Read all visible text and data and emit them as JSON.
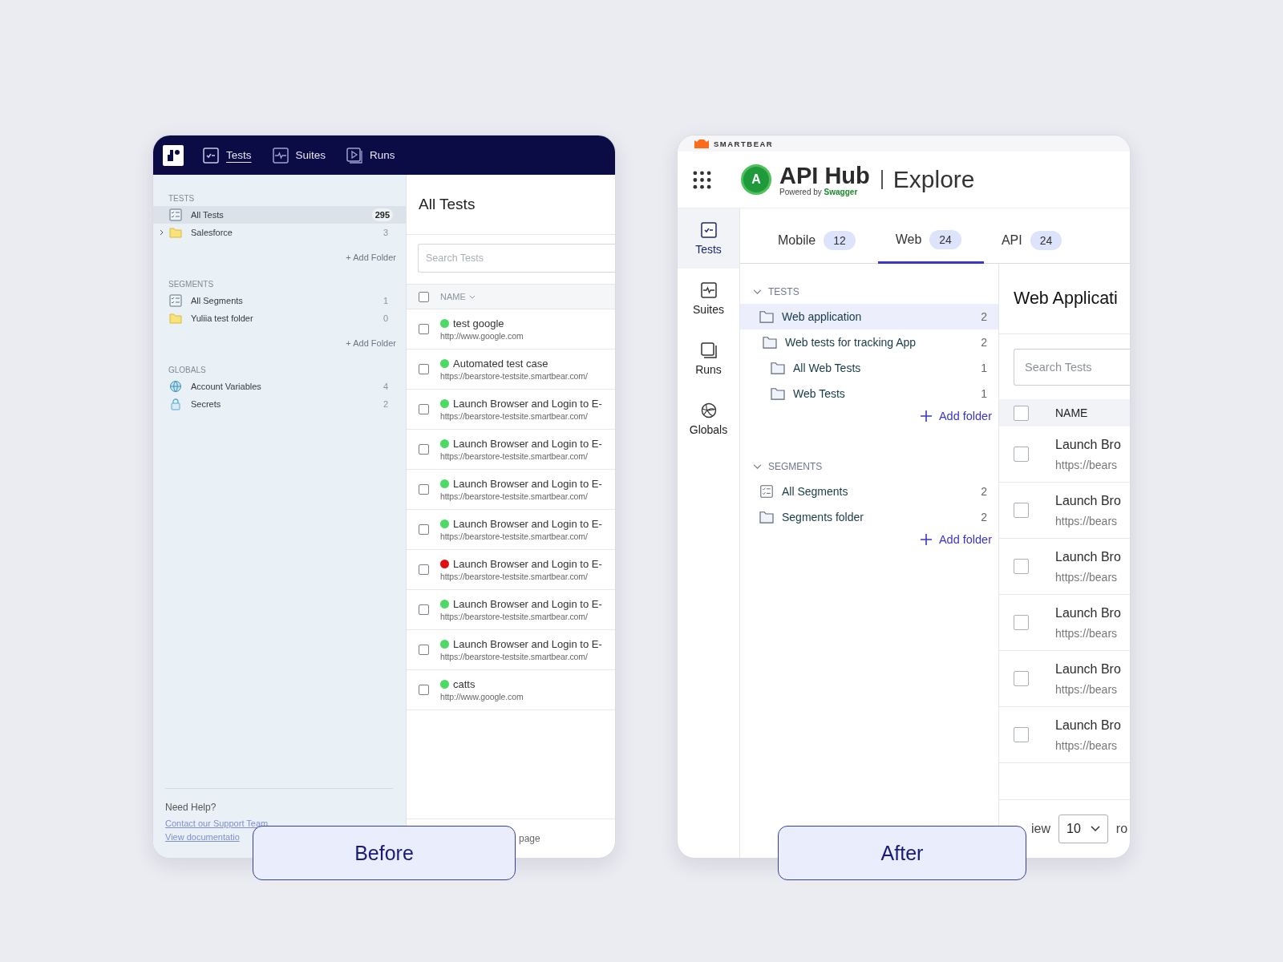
{
  "before": {
    "nav": {
      "tabs": [
        {
          "label": "Tests",
          "kind": "tests",
          "selected": true
        },
        {
          "label": "Suites",
          "kind": "suites",
          "selected": false
        },
        {
          "label": "Runs",
          "kind": "runs",
          "selected": false
        }
      ]
    },
    "sidebar": {
      "sections": [
        {
          "heading": "TESTS",
          "add_link": "+ Add Folder",
          "items": [
            {
              "label": "All Tests",
              "count": "295",
              "kind": "list",
              "selected": true,
              "collapsed": false
            },
            {
              "label": "Salesforce",
              "count": "3",
              "kind": "folder",
              "selected": false,
              "collapsed": true
            }
          ]
        },
        {
          "heading": "SEGMENTS",
          "add_link": "+ Add Folder",
          "items": [
            {
              "label": "All Segments",
              "count": "1",
              "kind": "list",
              "selected": false,
              "collapsed": false
            },
            {
              "label": "Yuliia test folder",
              "count": "0",
              "kind": "folder",
              "selected": false,
              "collapsed": false
            }
          ]
        },
        {
          "heading": "GLOBALS",
          "items": [
            {
              "label": "Account Variables",
              "count": "4",
              "kind": "globe",
              "selected": false,
              "collapsed": false
            },
            {
              "label": "Secrets",
              "count": "2",
              "kind": "lock",
              "selected": false,
              "collapsed": false
            }
          ]
        }
      ],
      "help": {
        "heading": "Need Help?",
        "links": [
          "Contact our Support Team",
          "View documentatio"
        ]
      }
    },
    "main": {
      "title": "All Tests",
      "search": {
        "placeholder": "Search Tests"
      },
      "column": "NAME",
      "all_checked": false,
      "rows": [
        {
          "name": "test google",
          "url": "http://www.google.com",
          "color": "#4cd964",
          "checked": false
        },
        {
          "name": "Automated test case",
          "url": "https://bearstore-testsite.smartbear.com/",
          "color": "#4cd964",
          "checked": false
        },
        {
          "name": "Launch Browser and Login to E-",
          "url": "https://bearstore-testsite.smartbear.com/",
          "color": "#4cd964",
          "checked": false
        },
        {
          "name": "Launch Browser and Login to E-",
          "url": "https://bearstore-testsite.smartbear.com/",
          "color": "#4cd964",
          "checked": false
        },
        {
          "name": "Launch Browser and Login to E-",
          "url": "https://bearstore-testsite.smartbear.com/",
          "color": "#4cd964",
          "checked": false
        },
        {
          "name": "Launch Browser and Login to E-",
          "url": "https://bearstore-testsite.smartbear.com/",
          "color": "#4cd964",
          "checked": false
        },
        {
          "name": "Launch Browser and Login to E-",
          "url": "https://bearstore-testsite.smartbear.com/",
          "color": "#e01010",
          "checked": false
        },
        {
          "name": "Launch Browser and Login to E-",
          "url": "https://bearstore-testsite.smartbear.com/",
          "color": "#4cd964",
          "checked": false
        },
        {
          "name": "Launch Browser and Login to E-",
          "url": "https://bearstore-testsite.smartbear.com/",
          "color": "#4cd964",
          "checked": false
        },
        {
          "name": "catts",
          "url": "http://www.google.com",
          "color": "#4cd964",
          "checked": false
        }
      ],
      "footer": "page"
    },
    "caption": "Before"
  },
  "after": {
    "brand": "SMARTBEAR",
    "header": {
      "logo_letter": "A",
      "product": "API Hub",
      "section": "Explore",
      "powered_by": "Powered by",
      "powered_brand": "Swagger"
    },
    "rail": [
      {
        "label": "Tests",
        "kind": "tests",
        "selected": true
      },
      {
        "label": "Suites",
        "kind": "suites",
        "selected": false
      },
      {
        "label": "Runs",
        "kind": "runs",
        "selected": false
      },
      {
        "label": "Globals",
        "kind": "globals",
        "selected": false
      }
    ],
    "tabs": [
      {
        "label": "Mobile",
        "count": "12",
        "selected": false
      },
      {
        "label": "Web",
        "count": "24",
        "selected": true
      },
      {
        "label": "API",
        "count": "24",
        "selected": false
      }
    ],
    "tree": {
      "sections": [
        {
          "heading": "TESTS",
          "expanded": true,
          "add_link": "Add folder",
          "items": [
            {
              "label": "Web application",
              "count": "2",
              "kind": "folder",
              "selected": true,
              "children": [
                {
                  "label": "Web tests for tracking App",
                  "count": "2",
                  "kind": "folder",
                  "selected": false,
                  "children": [
                    {
                      "label": "All Web Tests",
                      "count": "1",
                      "kind": "folder",
                      "selected": false
                    },
                    {
                      "label": "Web Tests",
                      "count": "1",
                      "kind": "folder",
                      "selected": false
                    }
                  ]
                }
              ]
            }
          ]
        },
        {
          "heading": "SEGMENTS",
          "expanded": true,
          "add_link": "Add folder",
          "items": [
            {
              "label": "All Segments",
              "count": "2",
              "kind": "list",
              "selected": false
            },
            {
              "label": "Segments folder",
              "count": "2",
              "kind": "folder",
              "selected": false
            }
          ]
        }
      ]
    },
    "main": {
      "title": "Web Applicati",
      "search": {
        "placeholder": "Search Tests"
      },
      "column": "NAME",
      "all_checked": false,
      "rows": [
        {
          "name": "Launch Bro",
          "url": "https://bears",
          "checked": false
        },
        {
          "name": "Launch Bro",
          "url": "https://bears",
          "checked": false
        },
        {
          "name": "Launch Bro",
          "url": "https://bears",
          "checked": false
        },
        {
          "name": "Launch Bro",
          "url": "https://bears",
          "checked": false
        },
        {
          "name": "Launch Bro",
          "url": "https://bears",
          "checked": false
        },
        {
          "name": "Launch Bro",
          "url": "https://bears",
          "checked": false
        }
      ],
      "footer": {
        "view_label": "iew",
        "page_size": "10",
        "rows_label": "ro"
      }
    },
    "caption": "After"
  }
}
